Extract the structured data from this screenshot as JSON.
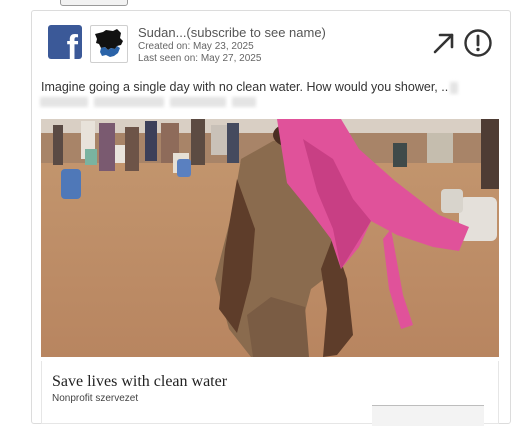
{
  "page": {
    "name": "Sudan...(subscribe to see name)",
    "created_on": "Created on: May 23, 2025",
    "last_seen_on": "Last seen on: May 27, 2025",
    "platform_icon": "facebook-icon",
    "platform_letter": "f",
    "avatar_icon": "sudan-map-icon"
  },
  "actions": {
    "open_icon": "external-link-arrow-icon",
    "info_icon": "exclamation-circle-icon"
  },
  "ad": {
    "body_text": "Imagine going a single day with no clean water. How would you shower, ..",
    "headline": "Save lives with clean water",
    "category": "Nonprofit szervezet"
  },
  "colors": {
    "facebook_blue": "#3b5998",
    "sudan_blue": "#2a63a8",
    "scarf_pink": "#e0529a",
    "icon_dark": "#333333"
  }
}
